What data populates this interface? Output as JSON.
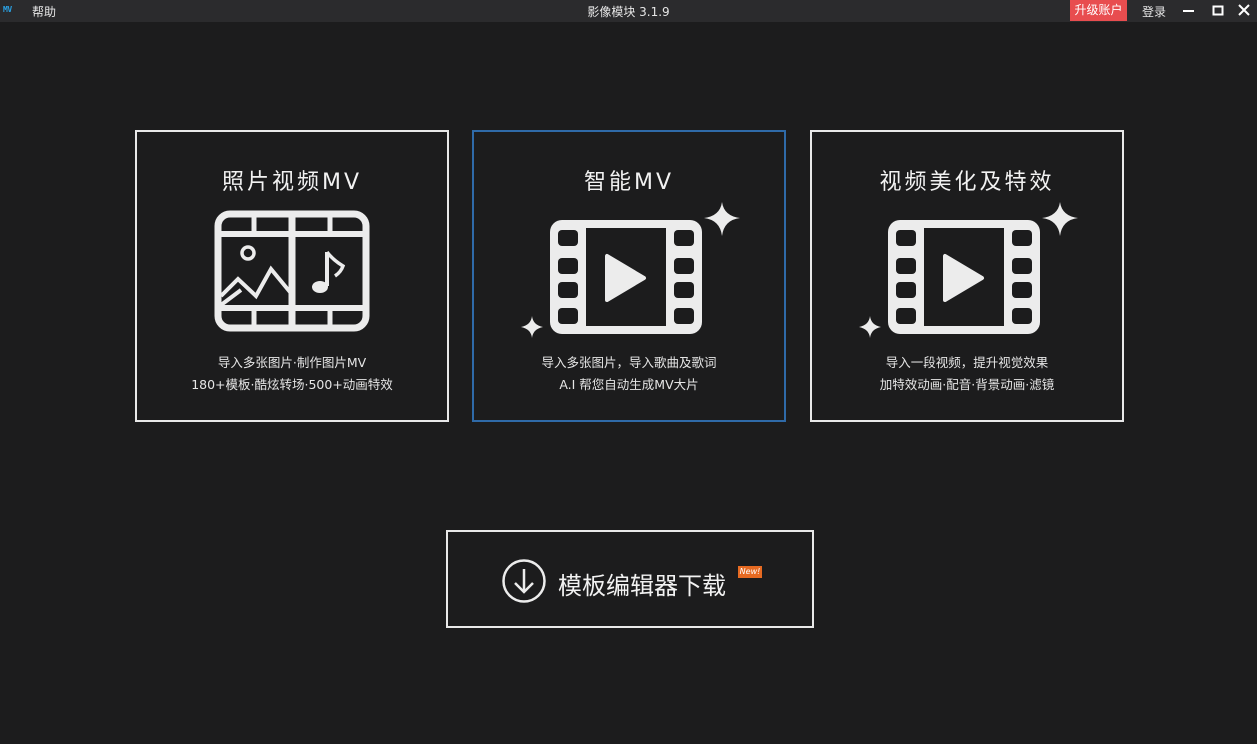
{
  "titlebar": {
    "logo_text": "MV",
    "help_label": "帮助",
    "title": "影像模块 3.1.9",
    "upgrade_label": "升级账户",
    "login_label": "登录",
    "upgrade_color": "#e84d4f"
  },
  "cards": [
    {
      "title": "照片视频MV",
      "line1": "导入多张图片·制作图片MV",
      "line2": "180+模板·酷炫转场·500+动画特效",
      "icon": "photo-music-filmstrip-icon"
    },
    {
      "title": "智能MV",
      "line1": "导入多张图片，导入歌曲及歌词",
      "line2": "A.I 帮您自动生成MV大片",
      "icon": "sparkle-play-filmstrip-icon",
      "selected_border_color": "#2f6aa8"
    },
    {
      "title": "视频美化及特效",
      "line1": "导入一段视频，提升视觉效果",
      "line2": "加特效动画·配音·背景动画·滤镜",
      "icon": "sparkle-play-filmstrip-icon"
    }
  ],
  "download": {
    "label": "模板编辑器下载",
    "badge": "New!",
    "icon": "download-arrow-icon",
    "badge_color": "#e66a22"
  }
}
